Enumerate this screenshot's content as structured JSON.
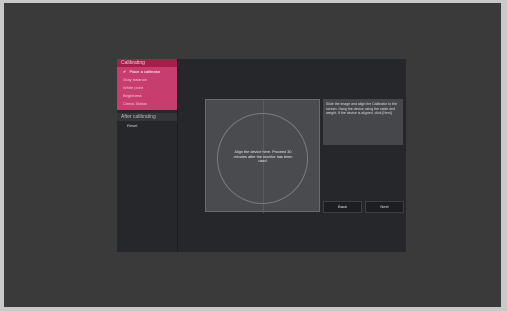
{
  "sidebar": {
    "calibrating_header": "Calibrating",
    "steps": [
      {
        "label": "Place a calibrator",
        "active": true
      },
      {
        "label": "Gray balance"
      },
      {
        "label": "White point"
      },
      {
        "label": "Brightness"
      },
      {
        "label": "Check Status"
      }
    ],
    "after_header": "After calibrating",
    "reset_label": "Reset"
  },
  "panel": {
    "text": "Align the device here. Proceed 30 minutes after the monitor has been used."
  },
  "instructions": {
    "text": "Slide the image and align the Calibrator to the screen. Hang the device using the cable and weight. If the device is aligned, click [Next]."
  },
  "buttons": {
    "back": "Back",
    "next": "Next"
  },
  "colors": {
    "accent_header": "#a81e4a",
    "accent_group": "#c73d6d",
    "app_background": "#26272b"
  }
}
